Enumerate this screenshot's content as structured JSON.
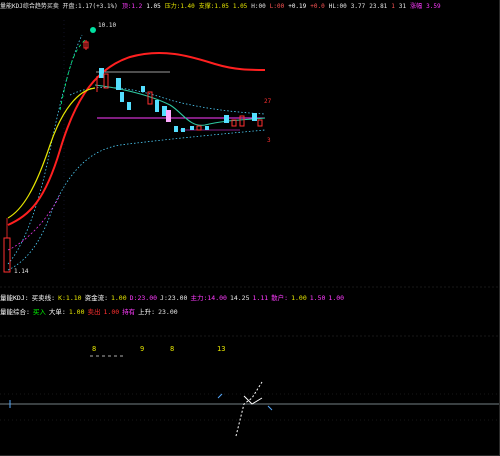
{
  "header": {
    "items": [
      {
        "text": "量能KDJ综合趋势买卖 开盘:1.17(+3.1%)",
        "color": "#e6e6e6"
      },
      {
        "text": "顶:1.2",
        "color": "#ff3bff"
      },
      {
        "text": "1.05",
        "color": "#ffffff"
      },
      {
        "text": "压力:1.40",
        "color": "#e6e600"
      },
      {
        "text": "支撑:1.05",
        "color": "#e6e600"
      },
      {
        "text": "1.05",
        "color": "#e6e600"
      },
      {
        "text": "H:00",
        "color": "#e6e6e6"
      },
      {
        "text": "L:00",
        "color": "#ff5555"
      },
      {
        "text": "+0.19",
        "color": "#ffffff"
      },
      {
        "text": "+0.0",
        "color": "#ff5555"
      },
      {
        "text": "HL:00",
        "color": "#e6e6e6"
      },
      {
        "text": "3.77",
        "color": "#e6e6e6"
      },
      {
        "text": "23.81",
        "color": "#e6e6e6"
      },
      {
        "text": "1",
        "color": "#ff5555"
      },
      {
        "text": "31",
        "color": "#e6e6e6"
      },
      {
        "text": "涨幅",
        "color": "#ff3bff"
      },
      {
        "text": "3.59",
        "color": "#ff3bff"
      }
    ]
  },
  "price_labels": {
    "high": "10.10",
    "low": "1.14",
    "right_up": "27",
    "right_down": "3"
  },
  "indicator_row1": {
    "items": [
      {
        "text": "量能KDJ:",
        "color": "#ffffff"
      },
      {
        "text": "买卖线:",
        "color": "#ffffff"
      },
      {
        "text": "K:1.10",
        "color": "#e6e600"
      },
      {
        "text": "资金流:",
        "color": "#ffffff"
      },
      {
        "text": "1.00",
        "color": "#e6e600"
      },
      {
        "text": "D:23.00",
        "color": "#ff3bff"
      },
      {
        "text": "J:23.00",
        "color": "#e6e6e6"
      },
      {
        "text": "主力:14.00",
        "color": "#ff3bff"
      },
      {
        "text": "14.25",
        "color": "#e6e6e6"
      },
      {
        "text": "1.11",
        "color": "#ff3bff"
      },
      {
        "text": "散户:",
        "color": "#ff3bff"
      },
      {
        "text": "1.00",
        "color": "#e6e600"
      },
      {
        "text": "1.50",
        "color": "#ff3bff"
      },
      {
        "text": "1.00",
        "color": "#ff3bff"
      }
    ]
  },
  "indicator_row2": {
    "items": [
      {
        "text": "量能综合:",
        "color": "#ffffff"
      },
      {
        "text": "买入",
        "color": "#00ff00"
      },
      {
        "text": "大单:",
        "color": "#ffffff"
      },
      {
        "text": "1.00",
        "color": "#e6e600"
      },
      {
        "text": "卖出",
        "color": "#ff3030"
      },
      {
        "text": "1.00",
        "color": "#ff3030"
      },
      {
        "text": "持有",
        "color": "#ff3bff"
      },
      {
        "text": "上升:",
        "color": "#ffffff"
      },
      {
        "text": "23.00",
        "color": "#e6e6e6"
      }
    ]
  },
  "counters": [
    {
      "text": "8",
      "color": "#e6e600"
    },
    {
      "text": "9",
      "color": "#e6e600"
    },
    {
      "text": "8",
      "color": "#e6e600"
    },
    {
      "text": "13",
      "color": "#e6e600"
    }
  ],
  "colors": {
    "background": "#000000",
    "up_candle": "#ff3030",
    "down_candle": "#55dfff",
    "ma_long": "#ff2020",
    "ma_mid": "#e6e600",
    "support_line": "#ff3bff",
    "resistance_line": "#d0d0d0",
    "band": "#4fd3ff",
    "guide": "#00ff7f"
  }
}
